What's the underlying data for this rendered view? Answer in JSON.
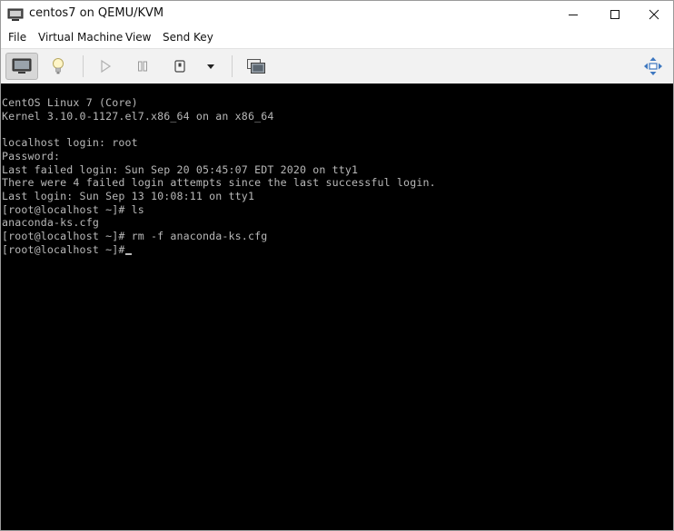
{
  "window": {
    "title": "centos7 on QEMU/KVM"
  },
  "menubar": {
    "items": [
      {
        "label": "File"
      },
      {
        "label": "Virtual Machine"
      },
      {
        "label": "View"
      },
      {
        "label": "Send Key"
      }
    ]
  },
  "toolbar": {
    "buttons": [
      {
        "icon": "console-icon",
        "active": true
      },
      {
        "icon": "lightbulb-icon",
        "active": false
      },
      {
        "icon": "play-icon",
        "active": false
      },
      {
        "icon": "pause-icon",
        "active": false
      },
      {
        "icon": "power-icon",
        "active": false
      },
      {
        "icon": "dropdown-arrow-icon",
        "active": false
      },
      {
        "icon": "snapshot-icon",
        "active": false
      },
      {
        "icon": "fullscreen-icon",
        "active": false
      }
    ]
  },
  "console": {
    "lines": [
      "CentOS Linux 7 (Core)",
      "Kernel 3.10.0-1127.el7.x86_64 on an x86_64",
      "",
      "localhost login: root",
      "Password:",
      "Last failed login: Sun Sep 20 05:45:07 EDT 2020 on tty1",
      "There were 4 failed login attempts since the last successful login.",
      "Last login: Sun Sep 13 10:08:11 on tty1",
      "[root@localhost ~]# ls",
      "anaconda-ks.cfg",
      "[root@localhost ~]# rm -f anaconda-ks.cfg",
      "[root@localhost ~]#"
    ],
    "colors": {
      "background": "#000000",
      "foreground": "#b8b8b8"
    }
  }
}
